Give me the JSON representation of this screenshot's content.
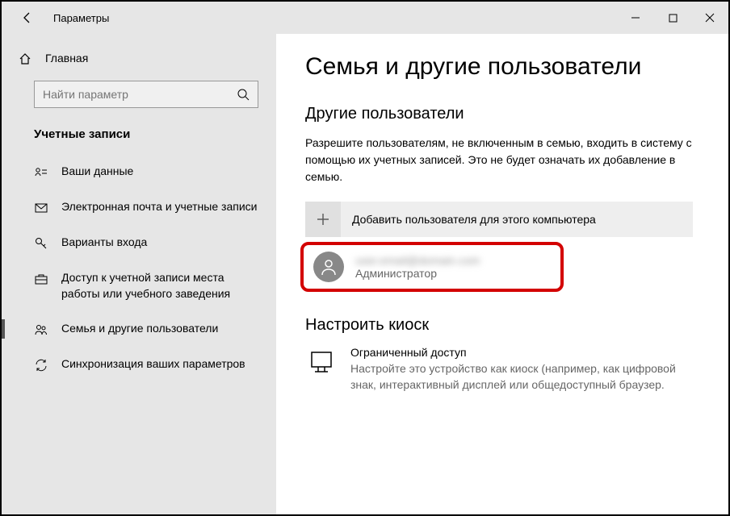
{
  "titlebar": {
    "title": "Параметры"
  },
  "sidebar": {
    "home": "Главная",
    "search_placeholder": "Найти параметр",
    "section": "Учетные записи",
    "items": [
      {
        "label": "Ваши данные"
      },
      {
        "label": "Электронная почта и учетные записи"
      },
      {
        "label": "Варианты входа"
      },
      {
        "label": "Доступ к учетной записи места работы или учебного заведения"
      },
      {
        "label": "Семья и другие пользователи"
      },
      {
        "label": "Синхронизация ваших параметров"
      }
    ]
  },
  "content": {
    "page_title": "Семья и другие пользователи",
    "other_users_header": "Другие пользователи",
    "other_users_desc": "Разрешите пользователям, не включенным в семью, входить в систему с помощью их учетных записей. Это не будет означать их добавление в семью.",
    "add_user_label": "Добавить пользователя для этого компьютера",
    "user": {
      "email": "user.email@domain.com",
      "role": "Администратор"
    },
    "kiosk_header": "Настроить киоск",
    "kiosk": {
      "title": "Ограниченный доступ",
      "desc": "Настройте это устройство как киоск (например, как цифровой знак, интерактивный дисплей или общедоступный браузер."
    }
  }
}
